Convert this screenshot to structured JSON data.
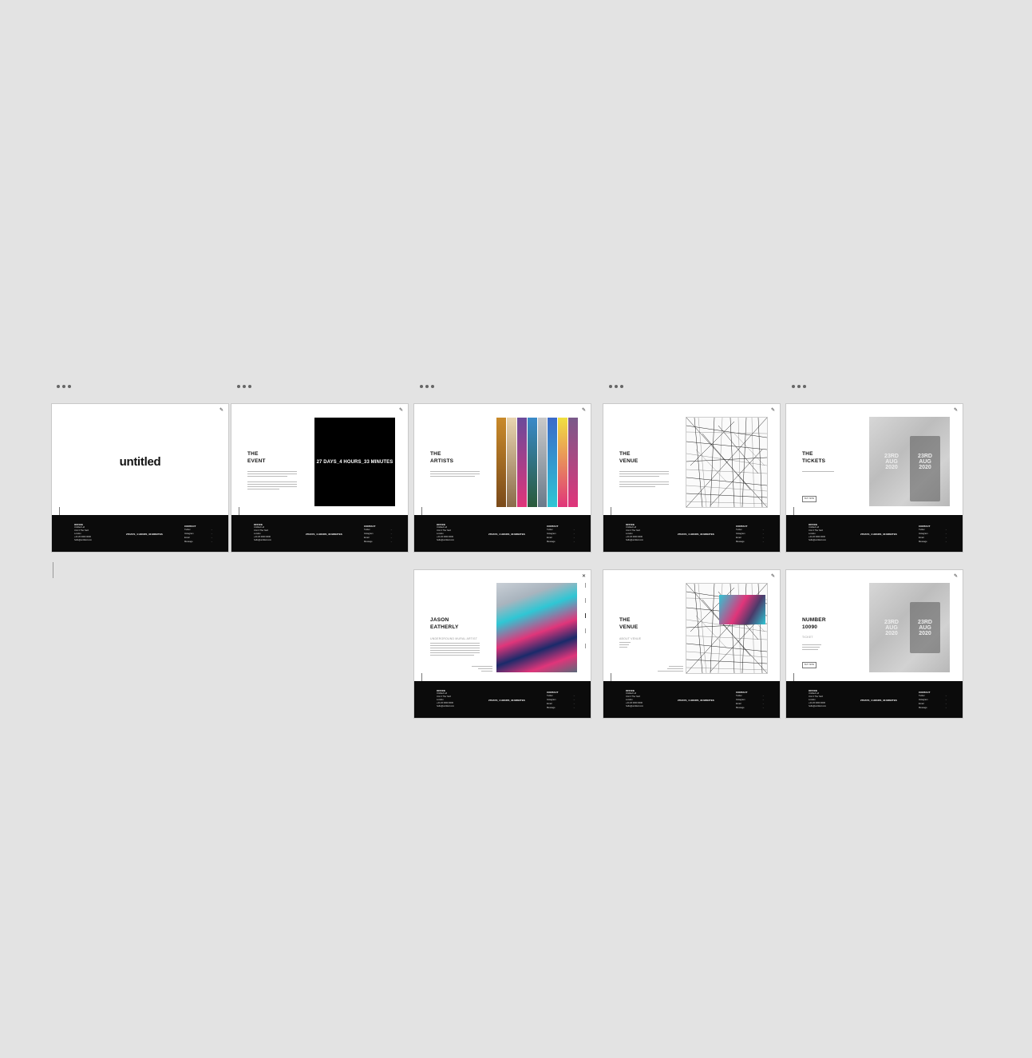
{
  "footer": {
    "office_label": "OFFICE",
    "office_lines": [
      "Untitled Ltd",
      "Unit 3 The Yard",
      "London",
      "+44 20 0000 0000",
      "hello@untitled.com"
    ],
    "countdown": "27DAYS_4 HOURS_33 MINUTES",
    "contact_label": "CONTACT",
    "contact_lines": [
      "Twitter",
      "Instagram",
      "Email",
      "Message"
    ]
  },
  "frames": {
    "home": {
      "logo_text": "untitled"
    },
    "event": {
      "title_line1": "THE",
      "title_line2": "EVENT",
      "countdown": "27 DAYS_4 HOURS_33 MINUTES"
    },
    "artists": {
      "title_line1": "THE",
      "title_line2": "ARTISTS"
    },
    "venue": {
      "title_line1": "THE",
      "title_line2": "VENUE"
    },
    "tickets": {
      "title_line1": "THE",
      "title_line2": "TICKETS",
      "button": "BUY NOW",
      "ticket_date": [
        "23RD",
        "AUG",
        "2020"
      ]
    },
    "artist_detail": {
      "title_line1": "JASON",
      "title_line2": "EATHERLY",
      "subtitle": "UNDERGROUND MURAL ARTIST"
    },
    "venue_detail": {
      "title_line1": "THE",
      "title_line2": "VENUE",
      "subtitle": "ABOUT VENUE"
    },
    "ticket_detail": {
      "title_line1": "NUMBER",
      "title_line2": "10090",
      "subtitle": "TICKET",
      "button": "BUY NOW",
      "ticket_date": [
        "23RD",
        "AUG",
        "2020"
      ]
    }
  },
  "colors": {
    "canvas": "#e3e3e3",
    "footer": "#0b0b0b",
    "accent_pink": "#e0357a",
    "accent_cyan": "#2fc6d4"
  },
  "icons": {
    "frame_menu": "more-dots-icon",
    "corner_logo": "logo-mark-icon"
  }
}
